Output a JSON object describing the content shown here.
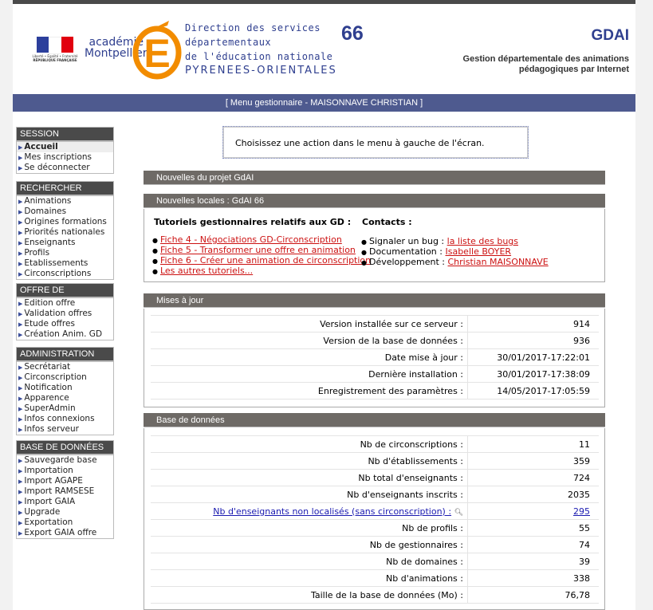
{
  "header": {
    "rf_lines": [
      "Liberté • Égalité • Fraternité",
      "RÉPUBLIQUE FRANÇAISE"
    ],
    "academie": [
      "académie",
      "Montpellier"
    ],
    "dsden_lines": [
      "Direction des services",
      "départementaux",
      "de l'éducation nationale",
      "PYRENEES-ORIENTALES"
    ],
    "dept_number": "66",
    "app_title": "GDAI",
    "app_subtitle_1": "Gestion départementale des animations",
    "app_subtitle_2": "pédagogiques par Internet"
  },
  "menu_bar": "[ Menu gestionnaire - MAISONNAVE CHRISTIAN ]",
  "sidebar": {
    "session": {
      "title": "SESSION",
      "items": [
        "Accueil",
        "Mes inscriptions",
        "Se déconnecter"
      ]
    },
    "rechercher": {
      "title": "RECHERCHER",
      "items": [
        "Animations",
        "Domaines",
        "Origines formations",
        "Priorités nationales",
        "Enseignants",
        "Profils",
        "Etablissements",
        "Circonscriptions"
      ]
    },
    "offre": {
      "title": "OFFRE DE FORMATION",
      "items": [
        "Edition offre",
        "Validation offres",
        "Etude offres",
        "Création Anim. GD"
      ]
    },
    "administration": {
      "title": "ADMINISTRATION",
      "items": [
        "Secrétariat",
        "Circonscription",
        "Notification",
        "Apparence",
        "SuperAdmin",
        "Infos connexions",
        "Infos serveur"
      ]
    },
    "base": {
      "title": "BASE DE DONNÉES",
      "items": [
        "Sauvegarde base",
        "Importation",
        "Import AGAPE",
        "Import RAMSESE",
        "Import GAIA",
        "Upgrade",
        "Exportation",
        "Export GAIA offre"
      ]
    }
  },
  "notice": "Choisissez une action dans le menu à gauche de l'écran.",
  "panels": {
    "news_project": "Nouvelles du projet GdAI",
    "news_local": "Nouvelles locales : GdAI 66",
    "mises_a_jour": "Mises à jour",
    "base_donnees": "Base de données"
  },
  "tutorials": {
    "title": "Tutoriels gestionnaires relatifs aux GD :",
    "links": [
      "Fiche 4 - Négociations GD-Circonscription",
      "Fiche 5 - Transformer une offre en animation",
      "Fiche 6 - Créer une animation de circonscription",
      "Les autres tutoriels..."
    ]
  },
  "contacts": {
    "title": "Contacts :",
    "items": [
      {
        "label": "Signaler un bug : ",
        "link": "la liste des bugs"
      },
      {
        "label": "Documentation : ",
        "link": "Isabelle BOYER"
      },
      {
        "label": "Développement : ",
        "link": "Christian MAISONNAVE"
      }
    ]
  },
  "updates": [
    {
      "k": "Version installée sur ce serveur :",
      "v": "914"
    },
    {
      "k": "Version de la base de données :",
      "v": "936"
    },
    {
      "k": "Date mise à jour :",
      "v": "30/01/2017-17:22:01"
    },
    {
      "k": "Dernière installation :",
      "v": "30/01/2017-17:38:09"
    },
    {
      "k": "Enregistrement des paramètres :",
      "v": "14/05/2017-17:05:59"
    }
  ],
  "db_stats": [
    {
      "k": "Nb de circonscriptions :",
      "v": "11"
    },
    {
      "k": "Nb d'établissements :",
      "v": "359"
    },
    {
      "k": "Nb total d'enseignants :",
      "v": "724"
    },
    {
      "k": "Nb d'enseignants inscrits :",
      "v": "2035"
    },
    {
      "k": "Nb d'enseignants non localisés (sans circonscription) :",
      "v": "295"
    },
    {
      "k": "Nb de profils :",
      "v": "55"
    },
    {
      "k": "Nb de gestionnaires :",
      "v": "74"
    },
    {
      "k": "Nb de domaines :",
      "v": "39"
    },
    {
      "k": "Nb d'animations :",
      "v": "338"
    },
    {
      "k": "Taille de la base de données (Mo) :",
      "v": "76,78"
    }
  ],
  "colors": {
    "brand_blue": "#2f3f8f",
    "menu_bar": "#4e5a8f",
    "panel_head": "#6e6a66",
    "link_red": "#cc1111",
    "orange_logo": "#f28c00"
  }
}
